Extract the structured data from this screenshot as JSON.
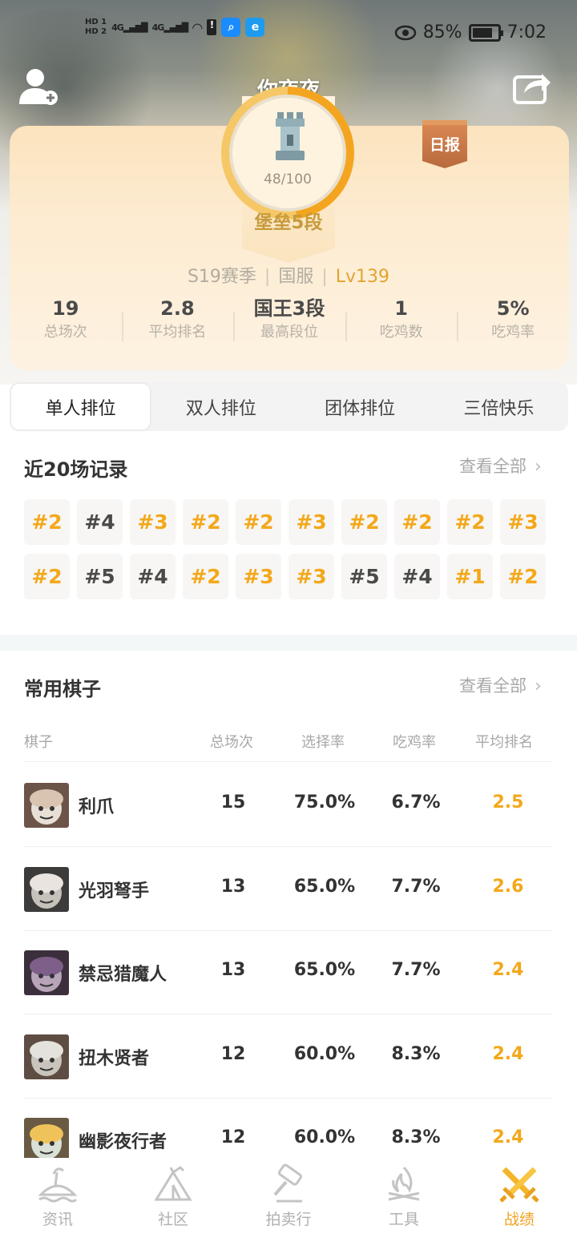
{
  "status_bar": {
    "hd1": "HD 1",
    "hd2": "HD 2",
    "network": "4G",
    "battery": "85%",
    "time": "7:02"
  },
  "header": {
    "player_name": "你夜夜",
    "add_friend_icon": "add-user-icon",
    "share_icon": "share-icon"
  },
  "profile": {
    "rank_progress": "48/100",
    "rank_title": "堡垒5段",
    "daily_badge": "日报",
    "season": "S19赛季",
    "server": "国服",
    "level": "Lv139",
    "stats": [
      {
        "value": "19",
        "label": "总场次"
      },
      {
        "value": "2.8",
        "label": "平均排名"
      },
      {
        "value": "国王3段",
        "label": "最高段位"
      },
      {
        "value": "1",
        "label": "吃鸡数"
      },
      {
        "value": "5%",
        "label": "吃鸡率"
      }
    ]
  },
  "mode_tabs": [
    {
      "label": "单人排位",
      "active": true
    },
    {
      "label": "双人排位",
      "active": false
    },
    {
      "label": "团体排位",
      "active": false
    },
    {
      "label": "三倍快乐",
      "active": false
    }
  ],
  "recent": {
    "title": "近20场记录",
    "view_all": "查看全部",
    "matches": [
      "#2",
      "#4",
      "#3",
      "#2",
      "#2",
      "#3",
      "#2",
      "#2",
      "#2",
      "#3",
      "#2",
      "#5",
      "#4",
      "#2",
      "#3",
      "#3",
      "#5",
      "#4",
      "#1",
      "#2"
    ]
  },
  "pieces": {
    "title": "常用棋子",
    "view_all": "查看全部",
    "columns": [
      "棋子",
      "总场次",
      "选择率",
      "吃鸡率",
      "平均排名"
    ],
    "rows": [
      {
        "name": "利爪",
        "games": "15",
        "pick_rate": "75.0%",
        "win_rate": "6.7%",
        "avg_rank": "2.5"
      },
      {
        "name": "光羽弩手",
        "games": "13",
        "pick_rate": "65.0%",
        "win_rate": "7.7%",
        "avg_rank": "2.6"
      },
      {
        "name": "禁忌猎魔人",
        "games": "13",
        "pick_rate": "65.0%",
        "win_rate": "7.7%",
        "avg_rank": "2.4"
      },
      {
        "name": "扭木贤者",
        "games": "12",
        "pick_rate": "60.0%",
        "win_rate": "8.3%",
        "avg_rank": "2.4"
      },
      {
        "name": "幽影夜行者",
        "games": "12",
        "pick_rate": "60.0%",
        "win_rate": "8.3%",
        "avg_rank": "2.4"
      }
    ]
  },
  "bottom_nav": [
    {
      "label": "资讯",
      "icon": "island-icon",
      "active": false
    },
    {
      "label": "社区",
      "icon": "tent-icon",
      "active": false
    },
    {
      "label": "拍卖行",
      "icon": "gavel-icon",
      "active": false
    },
    {
      "label": "工具",
      "icon": "campfire-icon",
      "active": false
    },
    {
      "label": "战绩",
      "icon": "crossed-swords-icon",
      "active": true
    }
  ],
  "colors": {
    "accent": "#f3a81a",
    "card_bg": "#fdebd0",
    "rank_gold": "#c79a3c",
    "active_nav": "#f0a423"
  }
}
